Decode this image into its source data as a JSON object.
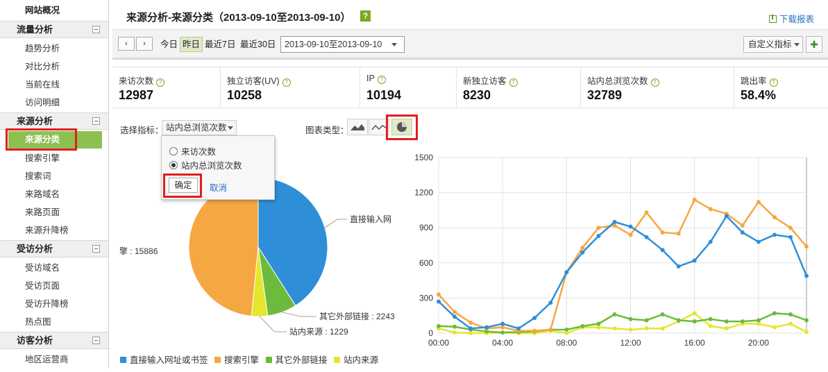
{
  "sidebar": {
    "top_item": "网站概况",
    "sections": [
      {
        "title": "流量分析",
        "items": [
          "趋势分析",
          "对比分析",
          "当前在线",
          "访问明细"
        ]
      },
      {
        "title": "来源分析",
        "items": [
          "来源分类",
          "搜索引擎",
          "搜索词",
          "来路域名",
          "来路页面",
          "来源升降榜"
        ]
      },
      {
        "title": "受访分析",
        "items": [
          "受访域名",
          "受访页面",
          "受访升降榜",
          "热点图"
        ]
      },
      {
        "title": "访客分析",
        "items": [
          "地区运营商"
        ]
      }
    ]
  },
  "header": {
    "title": "来源分析-来源分类（2013-09-10至2013-09-10）",
    "help": "?",
    "download": "下载报表"
  },
  "toolbar": {
    "prev": "‹",
    "next": "›",
    "today": "今日",
    "yesterday": "昨日",
    "last7": "最近7日",
    "last30": "最近30日",
    "date_range": "2013-09-10至2013-09-10",
    "custom_metrics": "自定义指标"
  },
  "metrics": [
    {
      "label": "来访次数",
      "value": "12987"
    },
    {
      "label": "独立访客(UV)",
      "value": "10258"
    },
    {
      "label": "IP",
      "value": "10194"
    },
    {
      "label": "新独立访客",
      "value": "8230"
    },
    {
      "label": "站内总浏览次数",
      "value": "32789"
    },
    {
      "label": "跳出率",
      "value": "58.4%"
    }
  ],
  "chart_controls": {
    "select_label": "选择指标：",
    "selected_metric": "站内总浏览次数",
    "chart_type_label": "图表类型：",
    "options": [
      "来访次数",
      "站内总浏览次数"
    ],
    "ok": "确定",
    "cancel": "取消"
  },
  "colors": {
    "blue": "#2f8ed8",
    "orange": "#f5a742",
    "green": "#6cbb3c",
    "yellow": "#e6e62e",
    "accent": "#8cc152"
  },
  "chart_data": [
    {
      "type": "pie",
      "labels": [
        "直接输入网址或书签",
        "搜索引擎",
        "其它外部链接",
        "站内来源"
      ],
      "values": [
        13431,
        15886,
        2243,
        1229
      ],
      "data_labels": [
        "直接输入网",
        "擎 : 15886",
        "其它外部链接 : 2243",
        "站内来源 : 1229"
      ]
    },
    {
      "type": "line",
      "x": [
        "00:00",
        "01:00",
        "02:00",
        "03:00",
        "04:00",
        "05:00",
        "06:00",
        "07:00",
        "08:00",
        "09:00",
        "10:00",
        "11:00",
        "12:00",
        "13:00",
        "14:00",
        "15:00",
        "16:00",
        "17:00",
        "18:00",
        "19:00",
        "20:00",
        "21:00",
        "22:00",
        "23:00"
      ],
      "x_tick_labels": [
        "00:00",
        "04:00",
        "08:00",
        "12:00",
        "16:00",
        "20:00"
      ],
      "y_tick_labels": [
        "0",
        "300",
        "600",
        "900",
        "1200",
        "1500"
      ],
      "ylim": [
        0,
        1500
      ],
      "series": [
        {
          "name": "直接输入网址或书签",
          "color": "#2f8ed8",
          "values": [
            270,
            140,
            40,
            50,
            80,
            40,
            130,
            260,
            520,
            690,
            830,
            950,
            910,
            820,
            710,
            570,
            620,
            780,
            1000,
            860,
            780,
            840,
            820,
            490
          ]
        },
        {
          "name": "搜索引擎",
          "color": "#f5a742",
          "values": [
            330,
            180,
            90,
            40,
            50,
            20,
            20,
            30,
            520,
            730,
            900,
            920,
            840,
            1030,
            860,
            850,
            1140,
            1060,
            1020,
            920,
            1120,
            990,
            900,
            740
          ]
        },
        {
          "name": "其它外部链接",
          "color": "#6cbb3c",
          "values": [
            60,
            55,
            30,
            15,
            5,
            10,
            15,
            30,
            30,
            60,
            80,
            160,
            120,
            110,
            160,
            110,
            100,
            120,
            100,
            100,
            110,
            170,
            160,
            110
          ]
        },
        {
          "name": "站内来源",
          "color": "#e6e62e",
          "values": [
            40,
            5,
            0,
            0,
            5,
            0,
            0,
            20,
            0,
            50,
            50,
            40,
            30,
            40,
            40,
            100,
            170,
            60,
            40,
            80,
            80,
            50,
            80,
            10
          ]
        }
      ]
    }
  ]
}
